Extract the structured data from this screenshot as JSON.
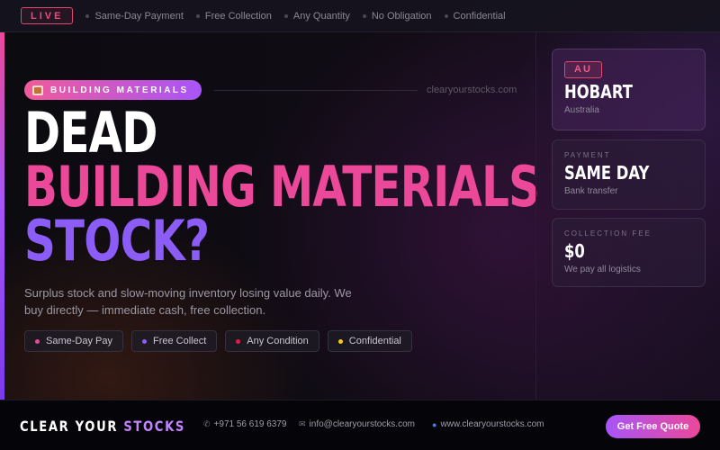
{
  "topbar": {
    "live_label": "LIVE",
    "ticker": [
      "Same-Day Payment",
      "Free Collection",
      "Any Quantity",
      "No Obligation",
      "Confidential"
    ]
  },
  "hero": {
    "category_label": "BUILDING MATERIALS",
    "site_url": "clearyourstocks.com",
    "headline": [
      "DEAD",
      "BUILDING MATERIALS",
      "STOCK?"
    ],
    "lede": "Surplus stock and slow-moving inventory losing value daily. We buy directly — immediate cash, free collection.",
    "chips": [
      {
        "label": "Same-Day Pay",
        "color": "#ec4899"
      },
      {
        "label": "Free Collect",
        "color": "#8b5cf6"
      },
      {
        "label": "Any Condition",
        "color": "#e11d48"
      },
      {
        "label": "Confidential",
        "color": "#facc15"
      }
    ]
  },
  "side": {
    "location": {
      "badge": "AU",
      "city": "HOBART",
      "country": "Australia"
    },
    "payment": {
      "label": "PAYMENT",
      "value": "SAME DAY",
      "sub": "Bank transfer"
    },
    "collection": {
      "label": "COLLECTION FEE",
      "value": "$0",
      "sub": "We pay all logistics"
    }
  },
  "footer": {
    "brand_a": "CLEAR YOUR ",
    "brand_b": "STOCKS",
    "phone": "+971 56 619 6379",
    "email": "info@clearyourstocks.com",
    "website": "www.clearyourstocks.com",
    "cta_label": "Get Free Quote"
  },
  "colors": {
    "accent_pink": "#ec4899",
    "accent_purple": "#8b5cf6",
    "background": "#0b0a10"
  }
}
